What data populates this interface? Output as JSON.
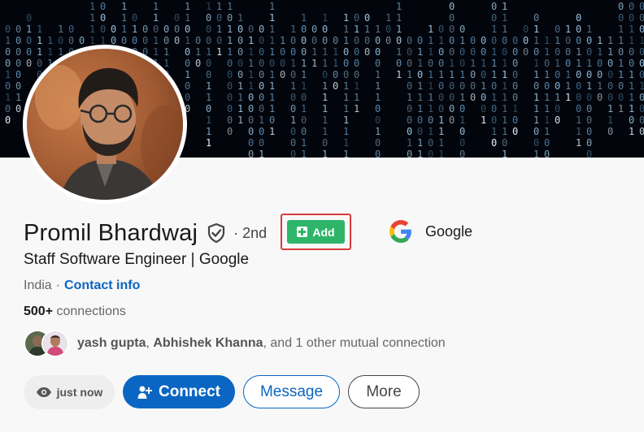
{
  "profile": {
    "name": "Promil Bhardwaj",
    "degree": "· 2nd",
    "headline": "Staff Software Engineer | Google",
    "location": "India",
    "location_separator": "·",
    "contact_label": "Contact info",
    "connections_count": "500+",
    "connections_label": "connections"
  },
  "add_button": {
    "label": "Add"
  },
  "company": {
    "name": "Google"
  },
  "mutual": {
    "name1": "yash gupta",
    "comma": ",",
    "name2": "Abhishek Khanna",
    "rest": ", and 1 other mutual connection"
  },
  "actions": {
    "viewed_label": "just now",
    "connect_label": "Connect",
    "message_label": "Message",
    "more_label": "More"
  },
  "colors": {
    "brand_blue": "#0a66c2",
    "add_green": "#2eb56a",
    "highlight_red": "#d93b3b"
  },
  "icons": {
    "verify": "shield-check-icon",
    "add": "plus-square-icon",
    "company": "google-logo-icon",
    "viewed": "eye-icon",
    "connect": "person-add-icon"
  }
}
